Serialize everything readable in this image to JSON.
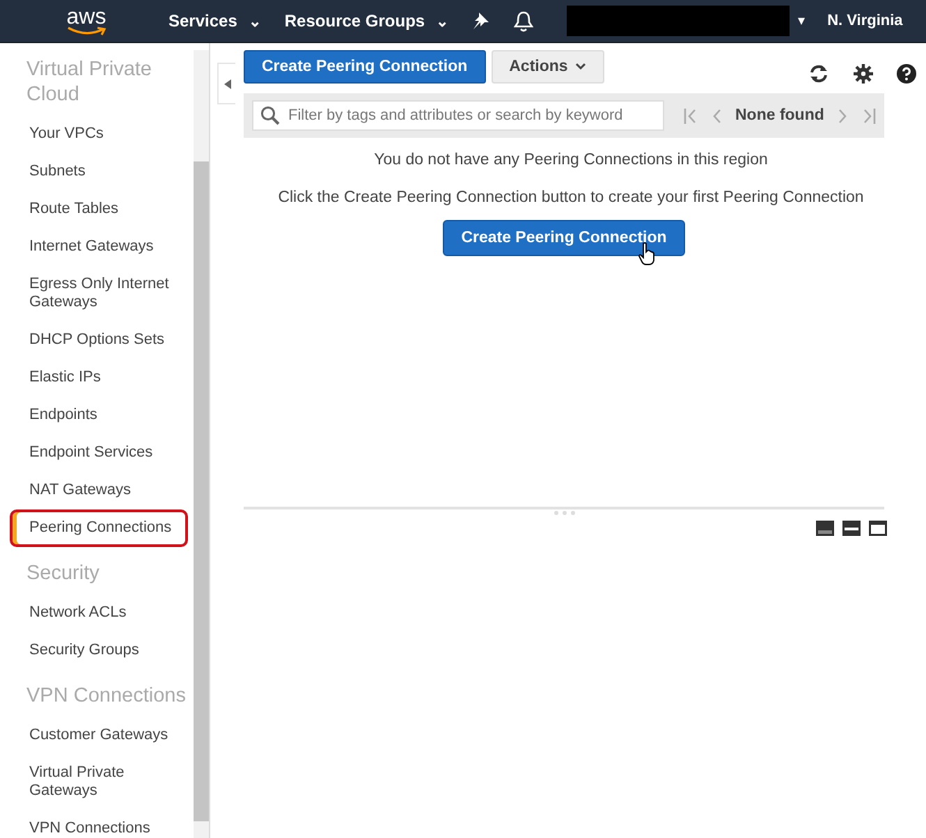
{
  "navbar": {
    "logo": "aws",
    "menus": [
      {
        "label": "Services",
        "caret": "⌄"
      },
      {
        "label": "Resource Groups",
        "caret": "⌄"
      }
    ],
    "account_caret": "▾",
    "region": "N. Virginia"
  },
  "sidebar": {
    "sections": [
      {
        "heading": "Virtual Private Cloud",
        "items": [
          {
            "label": "Your VPCs",
            "selected": false,
            "highlighted": false
          },
          {
            "label": "Subnets",
            "selected": false,
            "highlighted": false
          },
          {
            "label": "Route Tables",
            "selected": false,
            "highlighted": false
          },
          {
            "label": "Internet Gateways",
            "selected": false,
            "highlighted": false
          },
          {
            "label": "Egress Only Internet Gateways",
            "selected": false,
            "highlighted": false
          },
          {
            "label": "DHCP Options Sets",
            "selected": false,
            "highlighted": false
          },
          {
            "label": "Elastic IPs",
            "selected": false,
            "highlighted": false
          },
          {
            "label": "Endpoints",
            "selected": false,
            "highlighted": false
          },
          {
            "label": "Endpoint Services",
            "selected": false,
            "highlighted": false
          },
          {
            "label": "NAT Gateways",
            "selected": false,
            "highlighted": false
          },
          {
            "label": "Peering Connections",
            "selected": true,
            "highlighted": true
          }
        ]
      },
      {
        "heading": "Security",
        "items": [
          {
            "label": "Network ACLs",
            "selected": false,
            "highlighted": false
          },
          {
            "label": "Security Groups",
            "selected": false,
            "highlighted": false
          }
        ]
      },
      {
        "heading": "VPN Connections",
        "items": [
          {
            "label": "Customer Gateways",
            "selected": false,
            "highlighted": false
          },
          {
            "label": "Virtual Private Gateways",
            "selected": false,
            "highlighted": false
          },
          {
            "label": "VPN Connections",
            "selected": false,
            "highlighted": false
          }
        ]
      }
    ]
  },
  "toolbar": {
    "create_button": "Create Peering Connection",
    "actions_button": "Actions"
  },
  "filter": {
    "placeholder": "Filter by tags and attributes or search by keyword",
    "pager_text": "None found"
  },
  "empty_state": {
    "message": "You do not have any Peering Connections in this region",
    "hint": "Click the Create Peering Connection button to create your first Peering Connection",
    "button": "Create Peering Connection"
  }
}
